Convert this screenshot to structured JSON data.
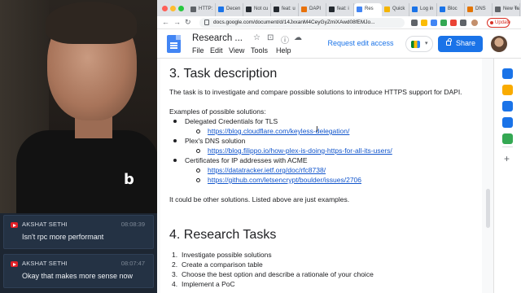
{
  "chat": {
    "messages": [
      {
        "author": "AKSHAT SETHI",
        "time": "08:08:39",
        "text": "Isn't rpc more performant"
      },
      {
        "author": "AKSHAT SETHI",
        "time": "08:07:47",
        "text": "Okay that makes more sense now"
      }
    ]
  },
  "browser": {
    "tabs": [
      {
        "label": "HTTP:",
        "color": "#5f6368"
      },
      {
        "label": "Decen",
        "color": "#1a73e8"
      },
      {
        "label": "Not cu",
        "color": "#24292f"
      },
      {
        "label": "feat: u",
        "color": "#24292f"
      },
      {
        "label": "DAPI",
        "color": "#e8710a"
      },
      {
        "label": "feat: i",
        "color": "#24292f"
      },
      {
        "label": "Res",
        "color": "#4285f4"
      },
      {
        "label": "Quick",
        "color": "#f4b400"
      },
      {
        "label": "Log in",
        "color": "#1a73e8"
      },
      {
        "label": "Bloc",
        "color": "#1a73e8"
      },
      {
        "label": "DNS",
        "color": "#e37400"
      },
      {
        "label": "New Tab",
        "color": "#5f6368"
      }
    ],
    "url": "docs.google.com/document/d/14JxxanM4CeyGyZmiXAwd08fEMJo...",
    "update_label": "Update"
  },
  "docs": {
    "title": "Research ...",
    "menu": [
      "File",
      "Edit",
      "View",
      "Tools",
      "Help"
    ],
    "request_edit": "Request edit access",
    "share_label": "Share"
  },
  "document": {
    "section3_heading": "3. Task description",
    "intro": "The task is to investigate and compare possible solutions to introduce HTTPS support for DAPI.",
    "examples_label": "Examples of possible solutions:",
    "solutions": [
      {
        "name": "Delegated Credentials for TLS",
        "links": [
          "https://blog.cloudflare.com/keyless-delegation/"
        ]
      },
      {
        "name": "Plex's DNS solution",
        "links": [
          "https://blog.filippo.io/how-plex-is-doing-https-for-all-its-users/"
        ]
      },
      {
        "name": "Certificates for IP addresses with ACME",
        "links": [
          "https://datatracker.ietf.org/doc/rfc8738/",
          "https://github.com/letsencrypt/boulder/issues/2706"
        ]
      }
    ],
    "closing": "It could be other solutions. Listed above are just examples.",
    "section4_heading": "4. Research Tasks",
    "tasks": [
      "Investigate possible solutions",
      "Create a comparison table",
      "Choose the best option and describe a rationale of your choice",
      "Implement a PoC"
    ]
  },
  "sidepanel": {
    "icons": [
      {
        "name": "calendar-icon",
        "color": "#1a73e8"
      },
      {
        "name": "keep-icon",
        "color": "#f9ab00"
      },
      {
        "name": "tasks-icon",
        "color": "#1a73e8"
      },
      {
        "name": "contacts-icon",
        "color": "#1a73e8"
      },
      {
        "name": "maps-icon",
        "color": "#34a853"
      }
    ]
  }
}
